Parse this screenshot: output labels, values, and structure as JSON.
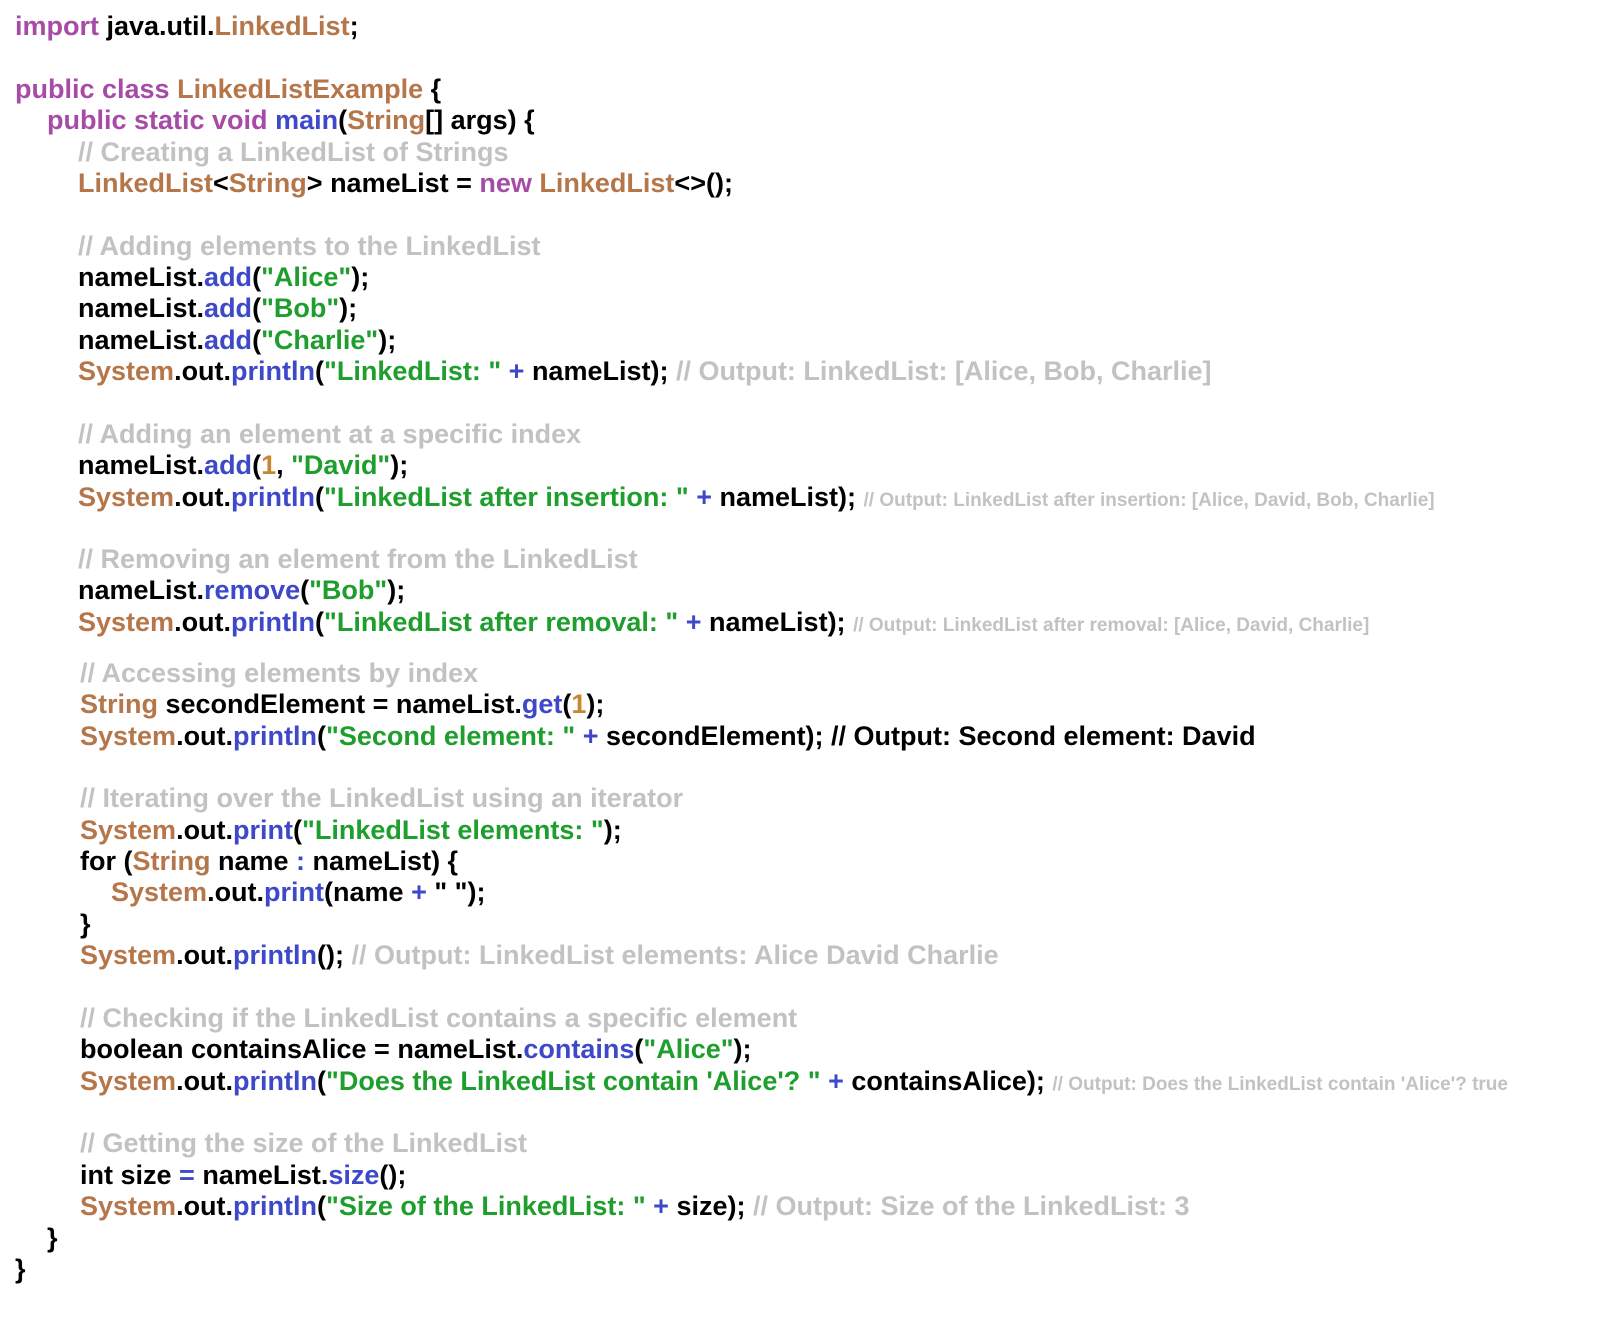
{
  "colors": {
    "keyword": "#a64ca6",
    "type": "#b5764a",
    "method": "#3d49c9",
    "string": "#1e9e2c",
    "number": "#c8862f",
    "operator": "#3d49c9",
    "comment": "#c2c2c2",
    "plain": "#000000"
  },
  "code_lines": [
    {
      "tokens": [
        [
          "keyword",
          "import"
        ],
        [
          "plain",
          " java.util."
        ],
        [
          "type",
          "LinkedList"
        ],
        [
          "plain",
          ";"
        ]
      ]
    },
    {
      "tokens": [
        [
          "keyword",
          "public class"
        ],
        [
          "plain",
          " "
        ],
        [
          "type",
          "LinkedListExample"
        ],
        [
          "plain",
          " {"
        ]
      ]
    },
    {
      "tokens": [
        [
          "keyword",
          "public static void"
        ],
        [
          "plain",
          " "
        ],
        [
          "method",
          "main"
        ],
        [
          "plain",
          "("
        ],
        [
          "type",
          "String"
        ],
        [
          "plain",
          "[] args) {"
        ]
      ]
    },
    {
      "tokens": [
        [
          "comment",
          "// Creating a LinkedList of Strings"
        ]
      ]
    },
    {
      "tokens": [
        [
          "type",
          "LinkedList"
        ],
        [
          "plain",
          "<"
        ],
        [
          "type",
          "String"
        ],
        [
          "plain",
          "> nameList = "
        ],
        [
          "keyword",
          "new"
        ],
        [
          "plain",
          " "
        ],
        [
          "type",
          "LinkedList"
        ],
        [
          "plain",
          "<>();"
        ]
      ]
    },
    {
      "tokens": [
        [
          "comment",
          "// Adding elements to the LinkedList"
        ]
      ]
    },
    {
      "tokens": [
        [
          "plain",
          "nameList."
        ],
        [
          "method",
          "add"
        ],
        [
          "plain",
          "("
        ],
        [
          "string",
          "\"Alice\""
        ],
        [
          "plain",
          ");"
        ]
      ]
    },
    {
      "tokens": [
        [
          "plain",
          "nameList."
        ],
        [
          "method",
          "add"
        ],
        [
          "plain",
          "("
        ],
        [
          "string",
          "\"Bob\""
        ],
        [
          "plain",
          ");"
        ]
      ]
    },
    {
      "tokens": [
        [
          "plain",
          "nameList."
        ],
        [
          "method",
          "add"
        ],
        [
          "plain",
          "("
        ],
        [
          "string",
          "\"Charlie\""
        ],
        [
          "plain",
          ");"
        ]
      ]
    },
    {
      "tokens": [
        [
          "type",
          "System"
        ],
        [
          "plain",
          ".out."
        ],
        [
          "method",
          "println"
        ],
        [
          "plain",
          "("
        ],
        [
          "string",
          "\"LinkedList: \""
        ],
        [
          "plain",
          " "
        ],
        [
          "operator",
          "+"
        ],
        [
          "plain",
          " nameList); "
        ],
        [
          "comment",
          "// Output: LinkedList: [Alice, Bob, Charlie]"
        ]
      ]
    },
    {
      "tokens": [
        [
          "comment",
          "// Adding an element at a specific index"
        ]
      ]
    },
    {
      "tokens": [
        [
          "plain",
          "nameList."
        ],
        [
          "method",
          "add"
        ],
        [
          "plain",
          "("
        ],
        [
          "number",
          "1"
        ],
        [
          "plain",
          ", "
        ],
        [
          "string",
          "\"David\""
        ],
        [
          "plain",
          ");"
        ]
      ]
    },
    {
      "tokens": [
        [
          "type",
          "System"
        ],
        [
          "plain",
          ".out."
        ],
        [
          "method",
          "println"
        ],
        [
          "plain",
          "("
        ],
        [
          "string",
          "\"LinkedList after insertion: \""
        ],
        [
          "plain",
          " "
        ],
        [
          "operator",
          "+"
        ],
        [
          "plain",
          " nameList); "
        ],
        [
          "comment_small",
          "// Output: LinkedList after insertion: [Alice, David, Bob, Charlie]"
        ]
      ]
    },
    {
      "tokens": [
        [
          "comment",
          "// Removing an element from the LinkedList"
        ]
      ]
    },
    {
      "tokens": [
        [
          "plain",
          "nameList."
        ],
        [
          "method",
          "remove"
        ],
        [
          "plain",
          "("
        ],
        [
          "string",
          "\"Bob\""
        ],
        [
          "plain",
          ");"
        ]
      ]
    },
    {
      "tokens": [
        [
          "type",
          "System"
        ],
        [
          "plain",
          ".out."
        ],
        [
          "method",
          "println"
        ],
        [
          "plain",
          "("
        ],
        [
          "string",
          "\"LinkedList after removal: \""
        ],
        [
          "plain",
          " "
        ],
        [
          "operator",
          "+"
        ],
        [
          "plain",
          " nameList); "
        ],
        [
          "comment_small",
          "// Output: LinkedList after removal: [Alice, David, Charlie]"
        ]
      ]
    },
    {
      "tokens": [
        [
          "comment",
          "// Accessing elements by index"
        ]
      ]
    },
    {
      "tokens": [
        [
          "type",
          "String"
        ],
        [
          "plain",
          " secondElement = nameList."
        ],
        [
          "method",
          "get"
        ],
        [
          "plain",
          "("
        ],
        [
          "number",
          "1"
        ],
        [
          "plain",
          ");"
        ]
      ]
    },
    {
      "tokens": [
        [
          "type",
          "System"
        ],
        [
          "plain",
          ".out."
        ],
        [
          "method",
          "println"
        ],
        [
          "plain",
          "("
        ],
        [
          "string",
          "\"Second element: \""
        ],
        [
          "plain",
          " "
        ],
        [
          "operator",
          "+"
        ],
        [
          "plain",
          " secondElement); // Output: Second element: David"
        ]
      ]
    },
    {
      "tokens": [
        [
          "comment",
          "// Iterating over the LinkedList using an iterator"
        ]
      ]
    },
    {
      "tokens": [
        [
          "type",
          "System"
        ],
        [
          "plain",
          ".out."
        ],
        [
          "method",
          "print"
        ],
        [
          "plain",
          "("
        ],
        [
          "string",
          "\"LinkedList elements: \""
        ],
        [
          "plain",
          ");"
        ]
      ]
    },
    {
      "tokens": [
        [
          "plain",
          "for ("
        ],
        [
          "type",
          "String"
        ],
        [
          "plain",
          " name "
        ],
        [
          "operator",
          ":"
        ],
        [
          "plain",
          " nameList) {"
        ]
      ]
    },
    {
      "tokens": [
        [
          "type",
          "System"
        ],
        [
          "plain",
          ".out."
        ],
        [
          "method",
          "print"
        ],
        [
          "plain",
          "(name "
        ],
        [
          "operator",
          "+"
        ],
        [
          "plain",
          " \" \");"
        ]
      ]
    },
    {
      "tokens": [
        [
          "plain",
          "}"
        ]
      ]
    },
    {
      "tokens": [
        [
          "type",
          "System"
        ],
        [
          "plain",
          ".out."
        ],
        [
          "method",
          "println"
        ],
        [
          "plain",
          "(); "
        ],
        [
          "comment",
          "// Output: LinkedList elements: Alice David Charlie"
        ]
      ]
    },
    {
      "tokens": [
        [
          "comment",
          "// Checking if the LinkedList contains a specific element"
        ]
      ]
    },
    {
      "tokens": [
        [
          "plain",
          "boolean containsAlice = nameList."
        ],
        [
          "method",
          "contains"
        ],
        [
          "plain",
          "("
        ],
        [
          "string",
          "\"Alice\""
        ],
        [
          "plain",
          ");"
        ]
      ]
    },
    {
      "tokens": [
        [
          "type",
          "System"
        ],
        [
          "plain",
          ".out."
        ],
        [
          "method",
          "println"
        ],
        [
          "plain",
          "("
        ],
        [
          "string",
          "\"Does the LinkedList contain 'Alice'? \""
        ],
        [
          "plain",
          " "
        ],
        [
          "operator",
          "+"
        ],
        [
          "plain",
          " containsAlice); "
        ],
        [
          "comment_small",
          "// Output: Does the LinkedList contain 'Alice'? true"
        ]
      ]
    },
    {
      "tokens": [
        [
          "comment",
          "// Getting the size of the LinkedList"
        ]
      ]
    },
    {
      "tokens": [
        [
          "plain",
          "int size "
        ],
        [
          "operator",
          "="
        ],
        [
          "plain",
          " nameList."
        ],
        [
          "method",
          "size"
        ],
        [
          "plain",
          "();"
        ]
      ]
    },
    {
      "tokens": [
        [
          "type",
          "System"
        ],
        [
          "plain",
          ".out."
        ],
        [
          "method",
          "println"
        ],
        [
          "plain",
          "("
        ],
        [
          "string",
          "\"Size of the LinkedList: \""
        ],
        [
          "plain",
          " "
        ],
        [
          "operator",
          "+"
        ],
        [
          "plain",
          " size); "
        ],
        [
          "comment",
          "// Output: Size of the LinkedList: 3"
        ]
      ]
    },
    {
      "tokens": [
        [
          "plain",
          "}"
        ]
      ]
    },
    {
      "tokens": [
        [
          "plain",
          "}"
        ]
      ]
    }
  ]
}
